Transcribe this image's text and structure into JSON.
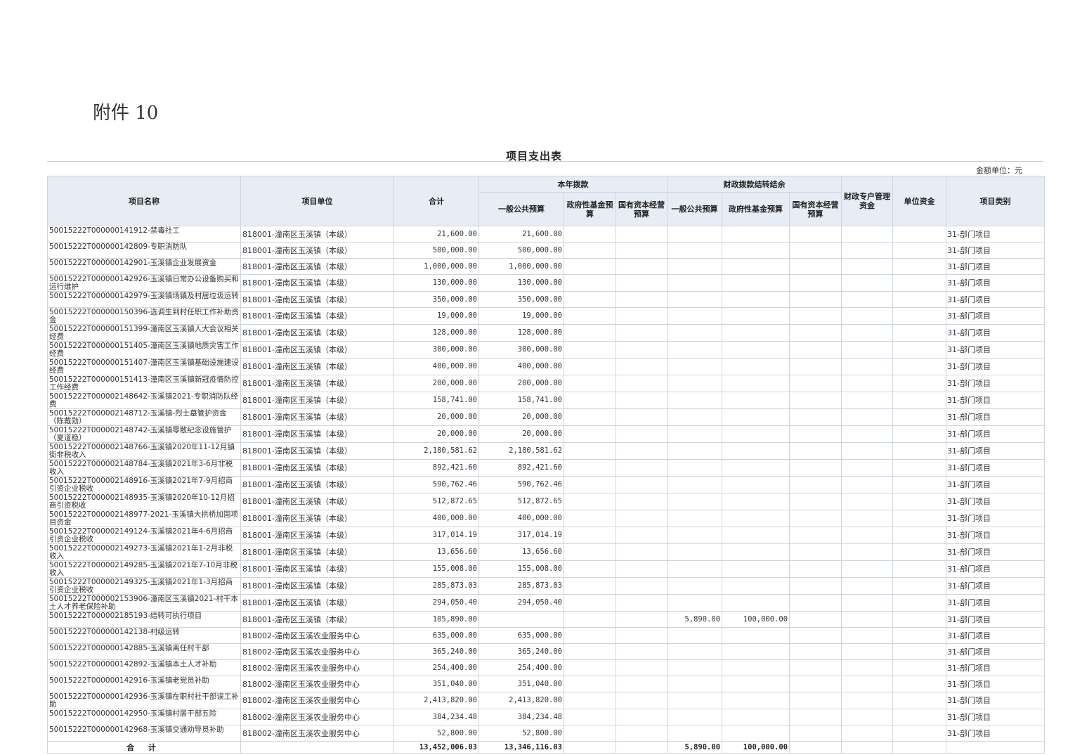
{
  "attachment": "附件 10",
  "title": "项目支出表",
  "unit_note": "金额单位：元",
  "headers": {
    "name": "项目名称",
    "unit": "项目单位",
    "total": "合计",
    "current_year": "本年拨款",
    "carryover": "财政拨款结转结余",
    "general_budget": "一般公共预算",
    "gov_fund_budget": "政府性基金预算",
    "state_capital_budget": "国有资本经营预算",
    "co_general_budget": "一般公共预算",
    "co_gov_fund_budget": "政府性基金预算",
    "co_state_capital_budget": "国有资本经营预算",
    "special_account": "财政专户管理资金",
    "unit_funds": "单位资金",
    "category": "项目类别"
  },
  "rows": [
    {
      "name": "50015222T000000141912-禁毒社工",
      "unit": "818001-潼南区玉溪镇（本级）",
      "total": "21,600.00",
      "general": "21,600.00",
      "co_general": "",
      "co_fund": "",
      "category": "31-部门项目"
    },
    {
      "name": "50015222T000000142809-专职消防队",
      "unit": "818001-潼南区玉溪镇（本级）",
      "total": "500,000.00",
      "general": "500,000.00",
      "co_general": "",
      "co_fund": "",
      "category": "31-部门项目"
    },
    {
      "name": "50015222T000000142901-玉溪镇企业发展资金",
      "unit": "818001-潼南区玉溪镇（本级）",
      "total": "1,000,000.00",
      "general": "1,000,000.00",
      "co_general": "",
      "co_fund": "",
      "category": "31-部门项目"
    },
    {
      "name": "50015222T000000142926-玉溪镇日常办公设备购买和运行维护",
      "unit": "818001-潼南区玉溪镇（本级）",
      "total": "130,000.00",
      "general": "130,000.00",
      "co_general": "",
      "co_fund": "",
      "category": "31-部门项目"
    },
    {
      "name": "50015222T000000142979-玉溪镇场镇及村居垃圾运转",
      "unit": "818001-潼南区玉溪镇（本级）",
      "total": "350,000.00",
      "general": "350,000.00",
      "co_general": "",
      "co_fund": "",
      "category": "31-部门项目"
    },
    {
      "name": "50015222T000000150396-选调生到村任职工作补助资金",
      "unit": "818001-潼南区玉溪镇（本级）",
      "total": "19,000.00",
      "general": "19,000.00",
      "co_general": "",
      "co_fund": "",
      "category": "31-部门项目"
    },
    {
      "name": "50015222T000000151399-潼南区玉溪镇人大会议相关经费",
      "unit": "818001-潼南区玉溪镇（本级）",
      "total": "128,000.00",
      "general": "128,000.00",
      "co_general": "",
      "co_fund": "",
      "category": "31-部门项目"
    },
    {
      "name": "50015222T000000151405-潼南区玉溪镇地质灾害工作经费",
      "unit": "818001-潼南区玉溪镇（本级）",
      "total": "300,000.00",
      "general": "300,000.00",
      "co_general": "",
      "co_fund": "",
      "category": "31-部门项目"
    },
    {
      "name": "50015222T000000151407-潼南区玉溪镇基础设施建设经费",
      "unit": "818001-潼南区玉溪镇（本级）",
      "total": "400,000.00",
      "general": "400,000.00",
      "co_general": "",
      "co_fund": "",
      "category": "31-部门项目"
    },
    {
      "name": "50015222T000000151413-潼南区玉溪镇新冠疫情防控工作经费",
      "unit": "818001-潼南区玉溪镇（本级）",
      "total": "200,000.00",
      "general": "200,000.00",
      "co_general": "",
      "co_fund": "",
      "category": "31-部门项目"
    },
    {
      "name": "50015222T000002148642-玉溪镇2021-专职消防队经费",
      "unit": "818001-潼南区玉溪镇（本级）",
      "total": "158,741.00",
      "general": "158,741.00",
      "co_general": "",
      "co_fund": "",
      "category": "31-部门项目"
    },
    {
      "name": "50015222T000002148712-玉溪镇-烈士墓管护资金（陈戴勋）",
      "unit": "818001-潼南区玉溪镇（本级）",
      "total": "20,000.00",
      "general": "20,000.00",
      "co_general": "",
      "co_fund": "",
      "category": "31-部门项目"
    },
    {
      "name": "50015222T000002148742-玉溪镇零散纪念设施管护（夏道稳）",
      "unit": "818001-潼南区玉溪镇（本级）",
      "total": "20,000.00",
      "general": "20,000.00",
      "co_general": "",
      "co_fund": "",
      "category": "31-部门项目"
    },
    {
      "name": "50015222T000002148766-玉溪镇2020年11-12月镇街非税收入",
      "unit": "818001-潼南区玉溪镇（本级）",
      "total": "2,180,581.62",
      "general": "2,180,581.62",
      "co_general": "",
      "co_fund": "",
      "category": "31-部门项目"
    },
    {
      "name": "50015222T000002148784-玉溪镇2021年3-6月非税收入",
      "unit": "818001-潼南区玉溪镇（本级）",
      "total": "892,421.60",
      "general": "892,421.60",
      "co_general": "",
      "co_fund": "",
      "category": "31-部门项目"
    },
    {
      "name": "50015222T000002148916-玉溪镇2021年7-9月招商引资企业税收",
      "unit": "818001-潼南区玉溪镇（本级）",
      "total": "590,762.46",
      "general": "590,762.46",
      "co_general": "",
      "co_fund": "",
      "category": "31-部门项目"
    },
    {
      "name": "50015222T000002148935-玉溪镇2020年10-12月招商引资税收",
      "unit": "818001-潼南区玉溪镇（本级）",
      "total": "512,872.65",
      "general": "512,872.65",
      "co_general": "",
      "co_fund": "",
      "category": "31-部门项目"
    },
    {
      "name": "50015222T000002148977-2021-玉溪镇大拱桥加固项目资金",
      "unit": "818001-潼南区玉溪镇（本级）",
      "total": "400,000.00",
      "general": "400,000.00",
      "co_general": "",
      "co_fund": "",
      "category": "31-部门项目"
    },
    {
      "name": "50015222T000002149124-玉溪镇2021年4-6月招商引资企业税收",
      "unit": "818001-潼南区玉溪镇（本级）",
      "total": "317,014.19",
      "general": "317,014.19",
      "co_general": "",
      "co_fund": "",
      "category": "31-部门项目"
    },
    {
      "name": "50015222T000002149273-玉溪镇2021年1-2月非税收入",
      "unit": "818001-潼南区玉溪镇（本级）",
      "total": "13,656.60",
      "general": "13,656.60",
      "co_general": "",
      "co_fund": "",
      "category": "31-部门项目"
    },
    {
      "name": "50015222T000002149285-玉溪镇2021年7-10月非税收入",
      "unit": "818001-潼南区玉溪镇（本级）",
      "total": "155,008.00",
      "general": "155,008.00",
      "co_general": "",
      "co_fund": "",
      "category": "31-部门项目"
    },
    {
      "name": "50015222T000002149325-玉溪镇2021年1-3月招商引资企业税收",
      "unit": "818001-潼南区玉溪镇（本级）",
      "total": "285,873.03",
      "general": "285,873.03",
      "co_general": "",
      "co_fund": "",
      "category": "31-部门项目"
    },
    {
      "name": "50015222T000002153906-潼南区玉溪镇2021-村干本土人才养老保险补助",
      "unit": "818001-潼南区玉溪镇（本级）",
      "total": "294,050.40",
      "general": "294,050.40",
      "co_general": "",
      "co_fund": "",
      "category": "31-部门项目"
    },
    {
      "name": "50015222T000002185193-结转可执行项目",
      "unit": "818001-潼南区玉溪镇（本级）",
      "total": "105,890.00",
      "general": "",
      "co_general": "5,890.00",
      "co_fund": "100,000.00",
      "category": "31-部门项目"
    },
    {
      "name": "50015222T000000142138-村级运转",
      "unit": "818002-潼南区玉溪农业服务中心",
      "total": "635,000.00",
      "general": "635,000.00",
      "co_general": "",
      "co_fund": "",
      "category": "31-部门项目"
    },
    {
      "name": "50015222T000000142885-玉溪镇离任村干部",
      "unit": "818002-潼南区玉溪农业服务中心",
      "total": "365,240.00",
      "general": "365,240.00",
      "co_general": "",
      "co_fund": "",
      "category": "31-部门项目"
    },
    {
      "name": "50015222T000000142892-玉溪镇本土人才补助",
      "unit": "818002-潼南区玉溪农业服务中心",
      "total": "254,400.00",
      "general": "254,400.00",
      "co_general": "",
      "co_fund": "",
      "category": "31-部门项目"
    },
    {
      "name": "50015222T000000142916-玉溪镇老党员补助",
      "unit": "818002-潼南区玉溪农业服务中心",
      "total": "351,040.00",
      "general": "351,040.00",
      "co_general": "",
      "co_fund": "",
      "category": "31-部门项目"
    },
    {
      "name": "50015222T000000142936-玉溪镇在职村社干部误工补助",
      "unit": "818002-潼南区玉溪农业服务中心",
      "total": "2,413,820.00",
      "general": "2,413,820.00",
      "co_general": "",
      "co_fund": "",
      "category": "31-部门项目"
    },
    {
      "name": "50015222T000000142950-玉溪镇村居干部五险",
      "unit": "818002-潼南区玉溪农业服务中心",
      "total": "384,234.48",
      "general": "384,234.48",
      "co_general": "",
      "co_fund": "",
      "category": "31-部门项目"
    },
    {
      "name": "50015222T000000142968-玉溪镇交通劝导员补助",
      "unit": "818002-潼南区玉溪农业服务中心",
      "total": "52,800.00",
      "general": "52,800.00",
      "co_general": "",
      "co_fund": "",
      "category": "31-部门项目"
    }
  ],
  "totals": {
    "label": "合 计",
    "total": "13,452,006.03",
    "general": "13,346,116.03",
    "co_general": "5,890.00",
    "co_fund": "100,000.00"
  }
}
